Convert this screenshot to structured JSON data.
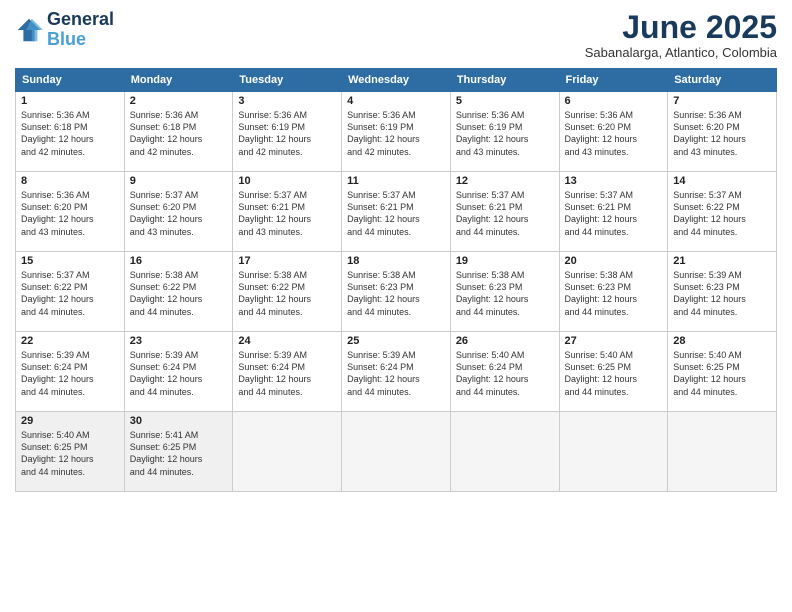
{
  "logo": {
    "line1": "General",
    "line2": "Blue"
  },
  "title": "June 2025",
  "subtitle": "Sabanalarga, Atlantico, Colombia",
  "weekdays": [
    "Sunday",
    "Monday",
    "Tuesday",
    "Wednesday",
    "Thursday",
    "Friday",
    "Saturday"
  ],
  "weeks": [
    [
      {
        "day": "1",
        "info": "Sunrise: 5:36 AM\nSunset: 6:18 PM\nDaylight: 12 hours\nand 42 minutes."
      },
      {
        "day": "2",
        "info": "Sunrise: 5:36 AM\nSunset: 6:18 PM\nDaylight: 12 hours\nand 42 minutes."
      },
      {
        "day": "3",
        "info": "Sunrise: 5:36 AM\nSunset: 6:19 PM\nDaylight: 12 hours\nand 42 minutes."
      },
      {
        "day": "4",
        "info": "Sunrise: 5:36 AM\nSunset: 6:19 PM\nDaylight: 12 hours\nand 42 minutes."
      },
      {
        "day": "5",
        "info": "Sunrise: 5:36 AM\nSunset: 6:19 PM\nDaylight: 12 hours\nand 43 minutes."
      },
      {
        "day": "6",
        "info": "Sunrise: 5:36 AM\nSunset: 6:20 PM\nDaylight: 12 hours\nand 43 minutes."
      },
      {
        "day": "7",
        "info": "Sunrise: 5:36 AM\nSunset: 6:20 PM\nDaylight: 12 hours\nand 43 minutes."
      }
    ],
    [
      {
        "day": "8",
        "info": "Sunrise: 5:36 AM\nSunset: 6:20 PM\nDaylight: 12 hours\nand 43 minutes."
      },
      {
        "day": "9",
        "info": "Sunrise: 5:37 AM\nSunset: 6:20 PM\nDaylight: 12 hours\nand 43 minutes."
      },
      {
        "day": "10",
        "info": "Sunrise: 5:37 AM\nSunset: 6:21 PM\nDaylight: 12 hours\nand 43 minutes."
      },
      {
        "day": "11",
        "info": "Sunrise: 5:37 AM\nSunset: 6:21 PM\nDaylight: 12 hours\nand 44 minutes."
      },
      {
        "day": "12",
        "info": "Sunrise: 5:37 AM\nSunset: 6:21 PM\nDaylight: 12 hours\nand 44 minutes."
      },
      {
        "day": "13",
        "info": "Sunrise: 5:37 AM\nSunset: 6:21 PM\nDaylight: 12 hours\nand 44 minutes."
      },
      {
        "day": "14",
        "info": "Sunrise: 5:37 AM\nSunset: 6:22 PM\nDaylight: 12 hours\nand 44 minutes."
      }
    ],
    [
      {
        "day": "15",
        "info": "Sunrise: 5:37 AM\nSunset: 6:22 PM\nDaylight: 12 hours\nand 44 minutes."
      },
      {
        "day": "16",
        "info": "Sunrise: 5:38 AM\nSunset: 6:22 PM\nDaylight: 12 hours\nand 44 minutes."
      },
      {
        "day": "17",
        "info": "Sunrise: 5:38 AM\nSunset: 6:22 PM\nDaylight: 12 hours\nand 44 minutes."
      },
      {
        "day": "18",
        "info": "Sunrise: 5:38 AM\nSunset: 6:23 PM\nDaylight: 12 hours\nand 44 minutes."
      },
      {
        "day": "19",
        "info": "Sunrise: 5:38 AM\nSunset: 6:23 PM\nDaylight: 12 hours\nand 44 minutes."
      },
      {
        "day": "20",
        "info": "Sunrise: 5:38 AM\nSunset: 6:23 PM\nDaylight: 12 hours\nand 44 minutes."
      },
      {
        "day": "21",
        "info": "Sunrise: 5:39 AM\nSunset: 6:23 PM\nDaylight: 12 hours\nand 44 minutes."
      }
    ],
    [
      {
        "day": "22",
        "info": "Sunrise: 5:39 AM\nSunset: 6:24 PM\nDaylight: 12 hours\nand 44 minutes."
      },
      {
        "day": "23",
        "info": "Sunrise: 5:39 AM\nSunset: 6:24 PM\nDaylight: 12 hours\nand 44 minutes."
      },
      {
        "day": "24",
        "info": "Sunrise: 5:39 AM\nSunset: 6:24 PM\nDaylight: 12 hours\nand 44 minutes."
      },
      {
        "day": "25",
        "info": "Sunrise: 5:39 AM\nSunset: 6:24 PM\nDaylight: 12 hours\nand 44 minutes."
      },
      {
        "day": "26",
        "info": "Sunrise: 5:40 AM\nSunset: 6:24 PM\nDaylight: 12 hours\nand 44 minutes."
      },
      {
        "day": "27",
        "info": "Sunrise: 5:40 AM\nSunset: 6:25 PM\nDaylight: 12 hours\nand 44 minutes."
      },
      {
        "day": "28",
        "info": "Sunrise: 5:40 AM\nSunset: 6:25 PM\nDaylight: 12 hours\nand 44 minutes."
      }
    ],
    [
      {
        "day": "29",
        "info": "Sunrise: 5:40 AM\nSunset: 6:25 PM\nDaylight: 12 hours\nand 44 minutes."
      },
      {
        "day": "30",
        "info": "Sunrise: 5:41 AM\nSunset: 6:25 PM\nDaylight: 12 hours\nand 44 minutes."
      },
      {
        "day": "",
        "info": ""
      },
      {
        "day": "",
        "info": ""
      },
      {
        "day": "",
        "info": ""
      },
      {
        "day": "",
        "info": ""
      },
      {
        "day": "",
        "info": ""
      }
    ]
  ]
}
